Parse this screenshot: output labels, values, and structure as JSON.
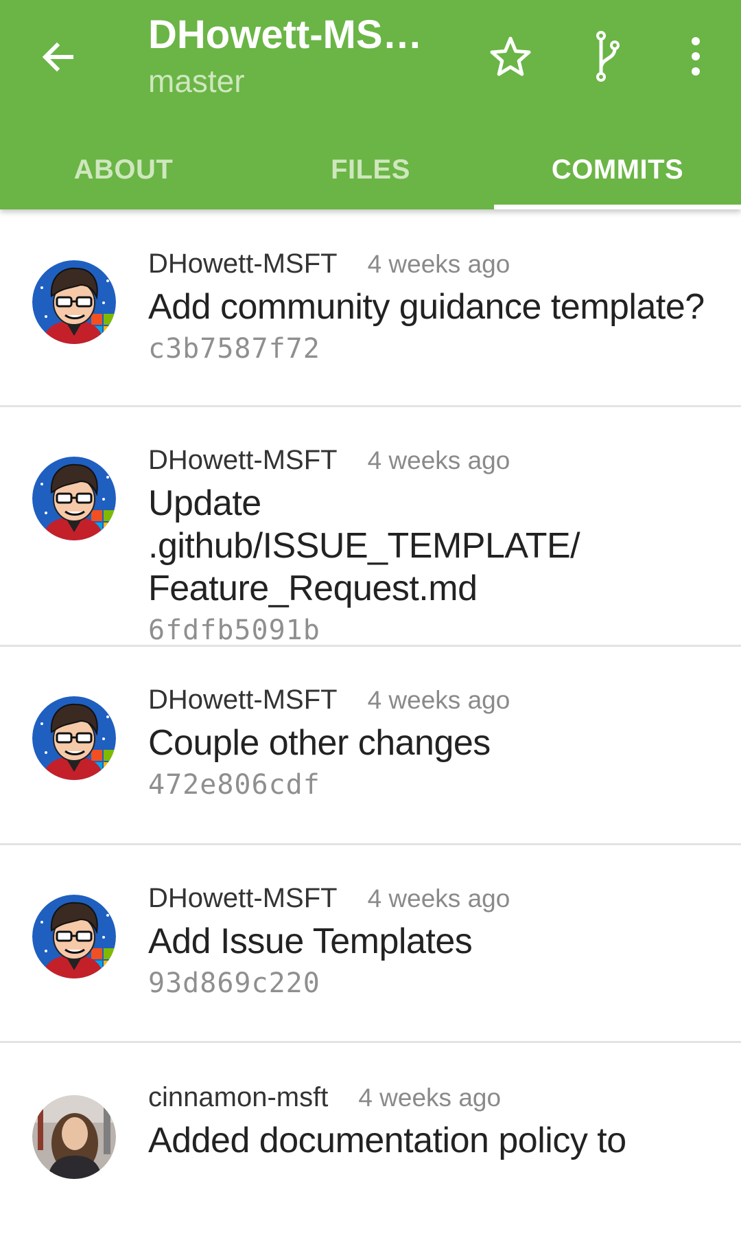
{
  "header": {
    "title": "DHowett-MSF…",
    "subtitle": "master",
    "colors": {
      "toolbar": "#6ab545",
      "tab_inactive": "#cfe7be"
    },
    "icons": [
      "back-arrow-icon",
      "star-icon",
      "branch-icon",
      "more-vert-icon"
    ]
  },
  "tabs": [
    {
      "label": "ABOUT",
      "active": false
    },
    {
      "label": "FILES",
      "active": false
    },
    {
      "label": "COMMITS",
      "active": true
    }
  ],
  "commits": [
    {
      "author": "DHowett-MSFT",
      "time": "4 weeks ago",
      "message": "Add community guidance template?",
      "sha": "c3b7587f72",
      "avatar": "cartoon-avatar"
    },
    {
      "author": "DHowett-MSFT",
      "time": "4 weeks ago",
      "message": "Update .github/ISSUE_TEMPLATE/ Feature_Request.md",
      "sha": "6fdfb5091b",
      "avatar": "cartoon-avatar"
    },
    {
      "author": "DHowett-MSFT",
      "time": "4 weeks ago",
      "message": "Couple other changes",
      "sha": "472e806cdf",
      "avatar": "cartoon-avatar"
    },
    {
      "author": "DHowett-MSFT",
      "time": "4 weeks ago",
      "message": "Add Issue Templates",
      "sha": "93d869c220",
      "avatar": "cartoon-avatar"
    },
    {
      "author": "cinnamon-msft",
      "time": "4 weeks ago",
      "message": "Added documentation policy to",
      "sha": "",
      "avatar": "photo-avatar"
    }
  ]
}
